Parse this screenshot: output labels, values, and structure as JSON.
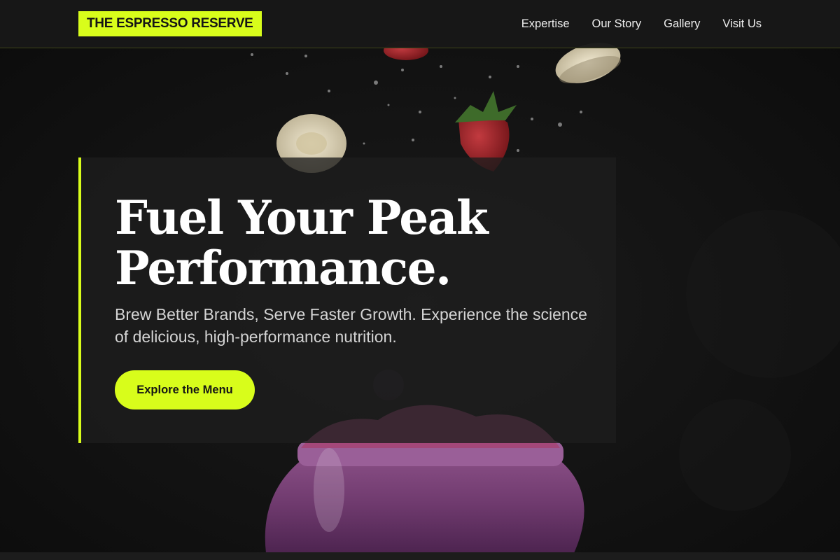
{
  "brand": {
    "name": "THE ESPRESSO RESERVE",
    "accent_color": "#d8fd1b"
  },
  "nav": {
    "items": [
      {
        "label": "Expertise"
      },
      {
        "label": "Our Story"
      },
      {
        "label": "Gallery"
      },
      {
        "label": "Visit Us"
      }
    ]
  },
  "hero": {
    "title": "Fuel Your Peak Performance.",
    "subtitle": "Brew Better Brands, Serve Faster Growth. Experience the science of delicious, high-performance nutrition.",
    "cta_label": "Explore the Menu"
  },
  "background": {
    "subject": "smoothie-jar-with-falling-fruit",
    "icons": [
      "strawberry-icon",
      "banana-slice-icon",
      "smoothie-jar-icon"
    ]
  }
}
